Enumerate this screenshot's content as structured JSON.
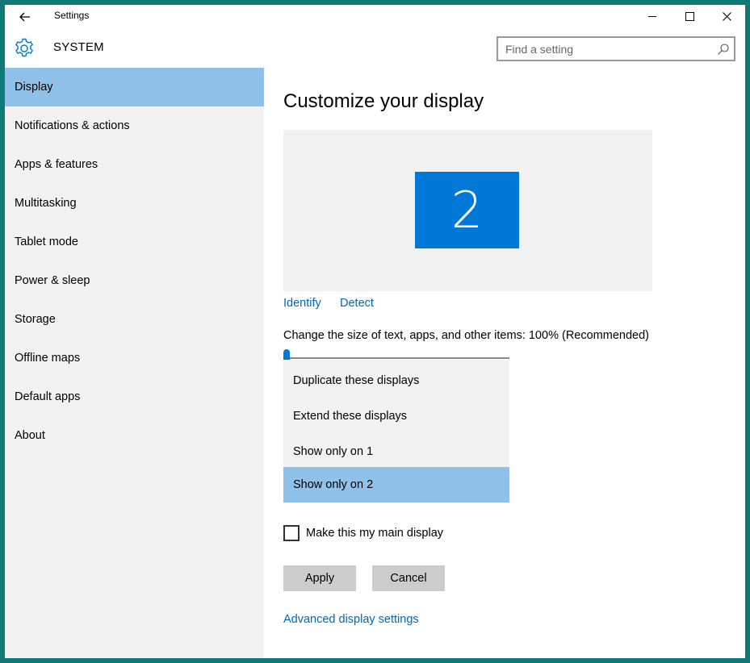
{
  "window": {
    "title": "Settings",
    "controls": {
      "minimize": "minimize-icon",
      "maximize": "maximize-icon",
      "close": "close-icon"
    }
  },
  "header": {
    "section": "SYSTEM",
    "search_placeholder": "Find a setting"
  },
  "sidebar": {
    "items": [
      {
        "label": "Display",
        "active": true
      },
      {
        "label": "Notifications & actions"
      },
      {
        "label": "Apps & features"
      },
      {
        "label": "Multitasking"
      },
      {
        "label": "Tablet mode"
      },
      {
        "label": "Power & sleep"
      },
      {
        "label": "Storage"
      },
      {
        "label": "Offline maps"
      },
      {
        "label": "Default apps"
      },
      {
        "label": "About"
      }
    ]
  },
  "main": {
    "title": "Customize your display",
    "monitor_number": "2",
    "identify": "Identify",
    "detect": "Detect",
    "size_label": "Change the size of text, apps, and other items: 100% (Recommended)",
    "slider_value_percent": 100,
    "multiple_displays_options": [
      {
        "label": "Duplicate these displays"
      },
      {
        "label": "Extend these displays"
      },
      {
        "label": "Show only on 1"
      },
      {
        "label": "Show only on 2",
        "selected": true
      }
    ],
    "main_display_label": "Make this my main display",
    "main_display_checked": false,
    "apply": "Apply",
    "cancel": "Cancel",
    "advanced_link": "Advanced display settings"
  },
  "colors": {
    "accent": "#0078d7",
    "link": "#0067b8",
    "selection": "#90c1e8",
    "frame": "#0e7a78",
    "sidebar_bg": "#f2f2f2"
  }
}
